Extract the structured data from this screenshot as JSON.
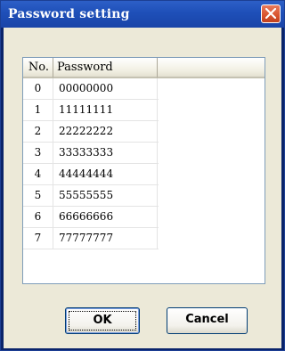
{
  "window": {
    "title": "Password setting"
  },
  "table": {
    "headers": {
      "no": "No.",
      "password": "Password"
    },
    "rows": [
      {
        "no": "0",
        "password": "00000000"
      },
      {
        "no": "1",
        "password": "11111111"
      },
      {
        "no": "2",
        "password": "22222222"
      },
      {
        "no": "3",
        "password": "33333333"
      },
      {
        "no": "4",
        "password": "44444444"
      },
      {
        "no": "5",
        "password": "55555555"
      },
      {
        "no": "6",
        "password": "66666666"
      },
      {
        "no": "7",
        "password": "77777777"
      }
    ]
  },
  "buttons": {
    "ok": "OK",
    "cancel": "Cancel"
  }
}
